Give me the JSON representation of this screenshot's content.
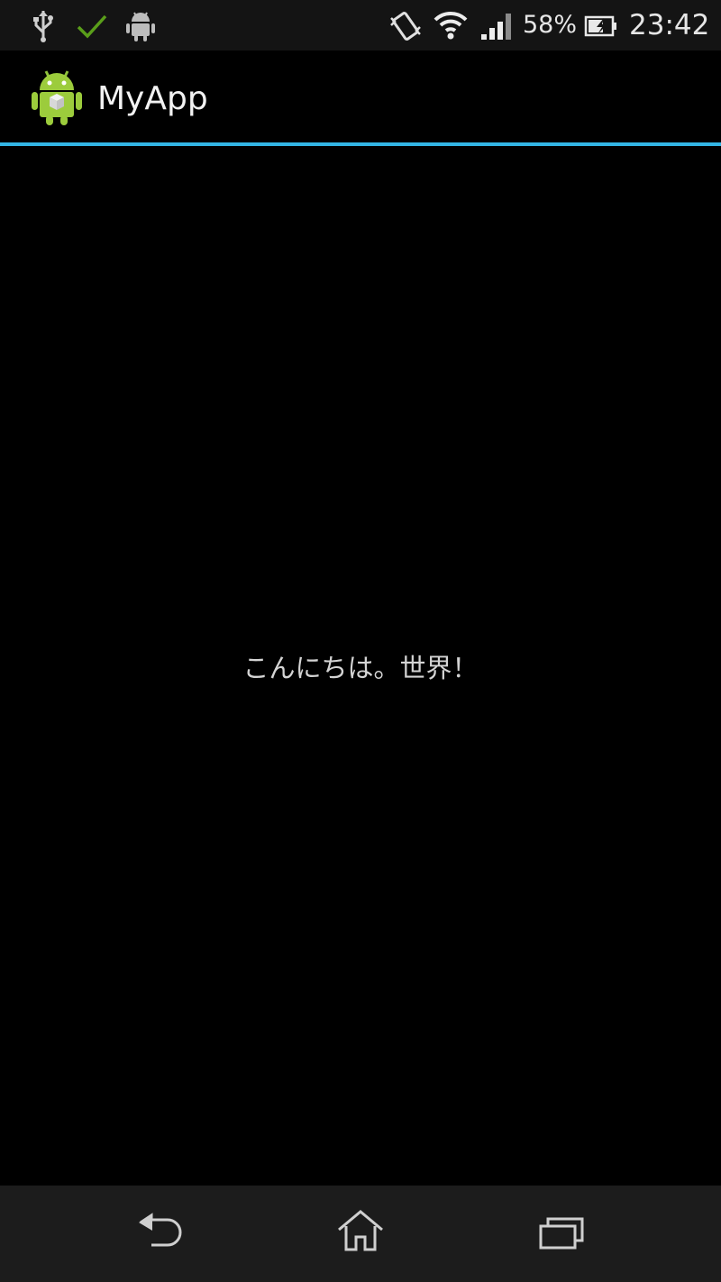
{
  "status_bar": {
    "icons": [
      "usb-icon",
      "check-icon",
      "android-notification-icon",
      "vibrate-icon",
      "wifi-icon",
      "signal-icon",
      "battery-charging-icon"
    ],
    "battery_percent": "58%",
    "time": "23:42",
    "colors": {
      "check": "#5a9e1a",
      "icon": "#d8d8d8"
    }
  },
  "action_bar": {
    "app_icon": "android-app-icon",
    "title": "MyApp",
    "divider_color": "#33b5e5"
  },
  "content": {
    "text": "こんにちは。世界！"
  },
  "nav_bar": {
    "buttons": [
      "back-icon",
      "home-icon",
      "recent-apps-icon"
    ]
  }
}
